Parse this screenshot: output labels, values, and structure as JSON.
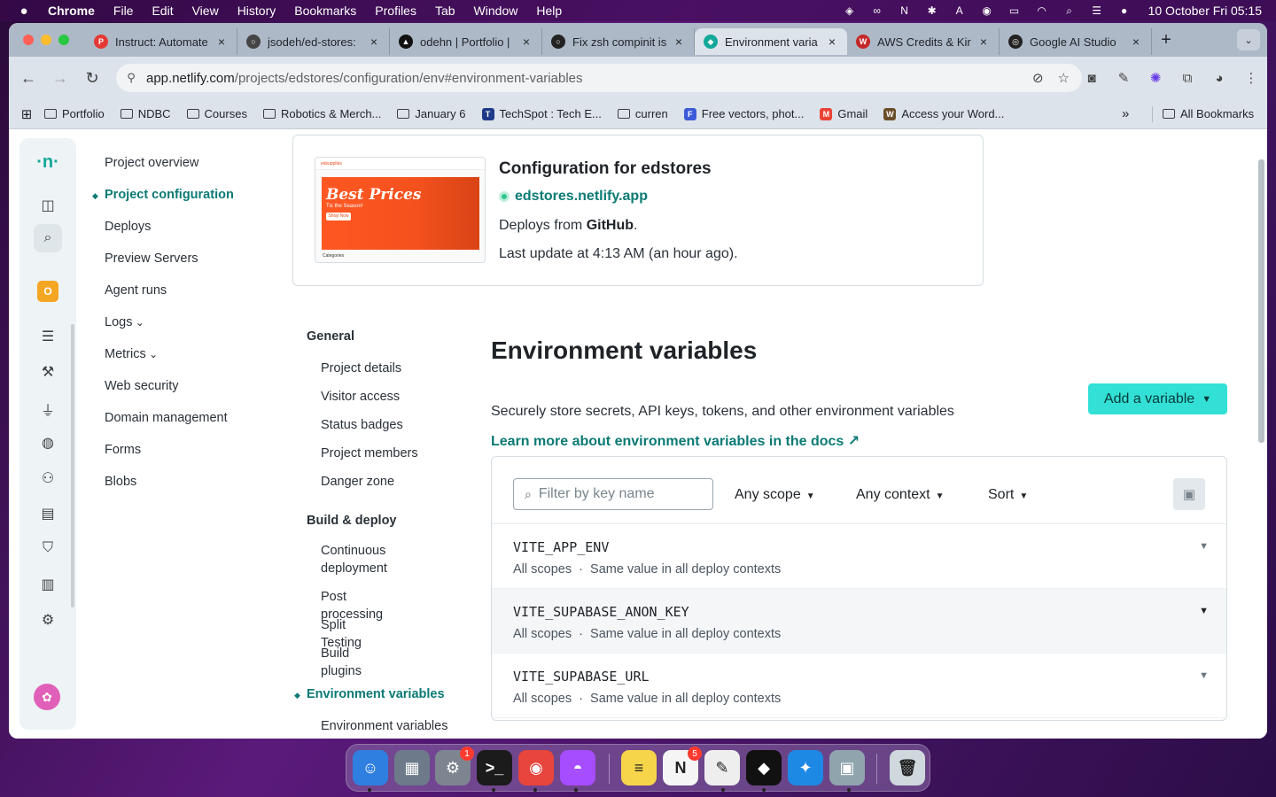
{
  "menubar": {
    "app": "Chrome",
    "items": [
      "File",
      "Edit",
      "View",
      "History",
      "Bookmarks",
      "Profiles",
      "Tab",
      "Window",
      "Help"
    ],
    "icons": [
      "dropbox-icon",
      "creative-cloud-icon",
      "notion-icon",
      "bluetooth-icon",
      "font-icon",
      "user-icon",
      "battery-icon",
      "wifi-icon",
      "search-icon",
      "control-center-icon",
      "siri-icon"
    ],
    "clock": "10 October Fri  05:15"
  },
  "tabs": [
    {
      "title": "Instruct: Automate",
      "color": "#e53935",
      "letter": "P"
    },
    {
      "title": "jsodeh/ed-stores:",
      "color": "#444444",
      "letter": "○"
    },
    {
      "title": "odehn | Portfolio |",
      "color": "#111111",
      "letter": "▲"
    },
    {
      "title": "Fix zsh compinit is",
      "color": "#222222",
      "letter": "○"
    },
    {
      "title": "Environment varia",
      "color": "#14a89a",
      "letter": "◆"
    },
    {
      "title": "AWS Credits & Kir",
      "color": "#c62828",
      "letter": "W"
    },
    {
      "title": "Google AI Studio",
      "color": "#222222",
      "letter": "◎"
    }
  ],
  "toolbar": {
    "url_host": "app.netlify.com",
    "url_path": "/projects/edstores/configuration/env#environment-variables"
  },
  "bookmarks": [
    {
      "label": "Portfolio",
      "kind": "folder"
    },
    {
      "label": "NDBC",
      "kind": "folder"
    },
    {
      "label": "Courses",
      "kind": "folder"
    },
    {
      "label": "Robotics & Merch...",
      "kind": "folder"
    },
    {
      "label": "January 6",
      "kind": "folder"
    },
    {
      "label": "TechSpot : Tech E...",
      "kind": "site",
      "color": "#1e3a8a",
      "letter": "T"
    },
    {
      "label": "curren",
      "kind": "folder"
    },
    {
      "label": "Free vectors, phot...",
      "kind": "site",
      "color": "#3b5bdb",
      "letter": "F"
    },
    {
      "label": "Gmail",
      "kind": "site",
      "color": "#ea4335",
      "letter": "M"
    },
    {
      "label": "Access your Word...",
      "kind": "site",
      "color": "#6b4f2a",
      "letter": "W"
    }
  ],
  "bookmarks_all": "All Bookmarks",
  "rail": {
    "org_letter": "O"
  },
  "mainnav": [
    {
      "label": "Project overview",
      "active": false
    },
    {
      "label": "Project configuration",
      "active": true
    },
    {
      "label": "Deploys",
      "active": false
    },
    {
      "label": "Preview Servers",
      "active": false
    },
    {
      "label": "Agent runs",
      "active": false
    },
    {
      "label": "Logs",
      "active": false,
      "expand": true
    },
    {
      "label": "Metrics",
      "active": false,
      "expand": true
    },
    {
      "label": "Web security",
      "active": false
    },
    {
      "label": "Domain management",
      "active": false
    },
    {
      "label": "Forms",
      "active": false
    },
    {
      "label": "Blobs",
      "active": false
    }
  ],
  "card": {
    "title": "Configuration for edstores",
    "site_url": "edstores.netlify.app",
    "deploys_prefix": "Deploys from ",
    "deploys_source": "GitHub",
    "deploys_suffix": ".",
    "last_update": "Last update at 4:13 AM (an hour ago).",
    "thumb": {
      "brand": "edsupplies",
      "headline": "Best Prices",
      "sub": "Tis the Season!",
      "cta": "Shop Now",
      "section": "Categories"
    }
  },
  "subnav": {
    "general_heading": "General",
    "general_items": [
      "Project details",
      "Visitor access",
      "Status badges",
      "Project members",
      "Danger zone"
    ],
    "build_heading": "Build & deploy",
    "build_items": [
      "Continuous\ndeployment",
      "Post processing",
      "Split Testing",
      "Build plugins"
    ],
    "env_heading": "Environment variables",
    "env_items": [
      "Environment variables"
    ]
  },
  "page": {
    "title": "Environment variables",
    "description": "Securely store secrets, API keys, tokens, and other environment variables",
    "learn_more": "Learn more about environment variables in the docs ↗",
    "add_button": "Add a variable"
  },
  "filters": {
    "placeholder": "Filter by key name",
    "scope": "Any scope",
    "context": "Any context",
    "sort": "Sort"
  },
  "variables": [
    {
      "key": "VITE_APP_ENV",
      "scopes": "All scopes",
      "contexts": "Same value in all deploy contexts"
    },
    {
      "key": "VITE_SUPABASE_ANON_KEY",
      "scopes": "All scopes",
      "contexts": "Same value in all deploy contexts"
    },
    {
      "key": "VITE_SUPABASE_URL",
      "scopes": "All scopes",
      "contexts": "Same value in all deploy contexts"
    }
  ],
  "dock": {
    "apps": [
      {
        "name": "finder",
        "color": "#2f7fe0",
        "glyph": "☺",
        "badge": ""
      },
      {
        "name": "launchpad",
        "color": "#6c7a89",
        "glyph": "▦",
        "badge": ""
      },
      {
        "name": "system-settings",
        "color": "#7d8590",
        "glyph": "⚙",
        "badge": "1"
      },
      {
        "name": "terminal",
        "color": "#1b1b1b",
        "glyph": ">_",
        "badge": ""
      },
      {
        "name": "chrome",
        "color": "#e8453c",
        "glyph": "◉",
        "badge": ""
      },
      {
        "name": "ghost",
        "color": "#a64dff",
        "glyph": "◓",
        "badge": ""
      },
      {
        "name": "notes",
        "color": "#f7d54a",
        "glyph": "≡",
        "badge": ""
      },
      {
        "name": "notion",
        "color": "#f5f5f5",
        "glyph": "N",
        "badge": "5"
      },
      {
        "name": "textedit",
        "color": "#eeeeee",
        "glyph": "✎",
        "badge": ""
      },
      {
        "name": "capcut",
        "color": "#111111",
        "glyph": "◆",
        "badge": ""
      },
      {
        "name": "safari",
        "color": "#1e88e5",
        "glyph": "✦",
        "badge": ""
      },
      {
        "name": "preview",
        "color": "#90a4ae",
        "glyph": "▣",
        "badge": ""
      },
      {
        "name": "trash",
        "color": "#cfd8dc",
        "glyph": "🗑",
        "badge": ""
      }
    ]
  }
}
